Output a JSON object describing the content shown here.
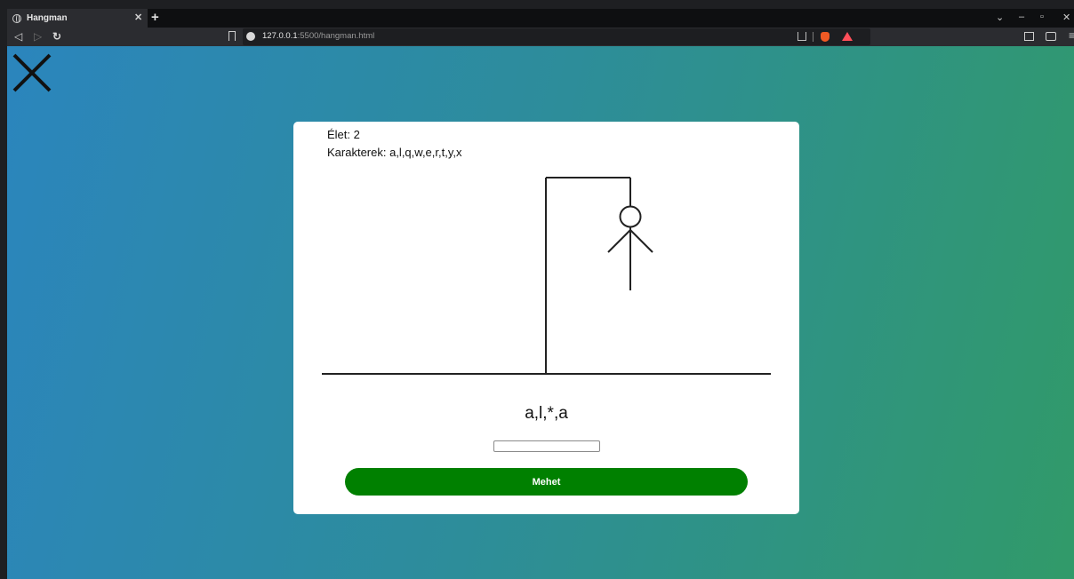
{
  "browser": {
    "tab_title": "Hangman",
    "url_host": "127.0.0.1",
    "url_rest": ":5500/hangman.html"
  },
  "game": {
    "lives_text": "Élet: 2",
    "characters_text": "Karakterek: a,l,q,w,e,r,t,y,x",
    "word_display": "a,l,*,a",
    "guess_value": "",
    "submit_label": "Mehet"
  },
  "colors": {
    "button": "#008000",
    "gradient_left": "#2b85bd",
    "gradient_right": "#319a69"
  }
}
